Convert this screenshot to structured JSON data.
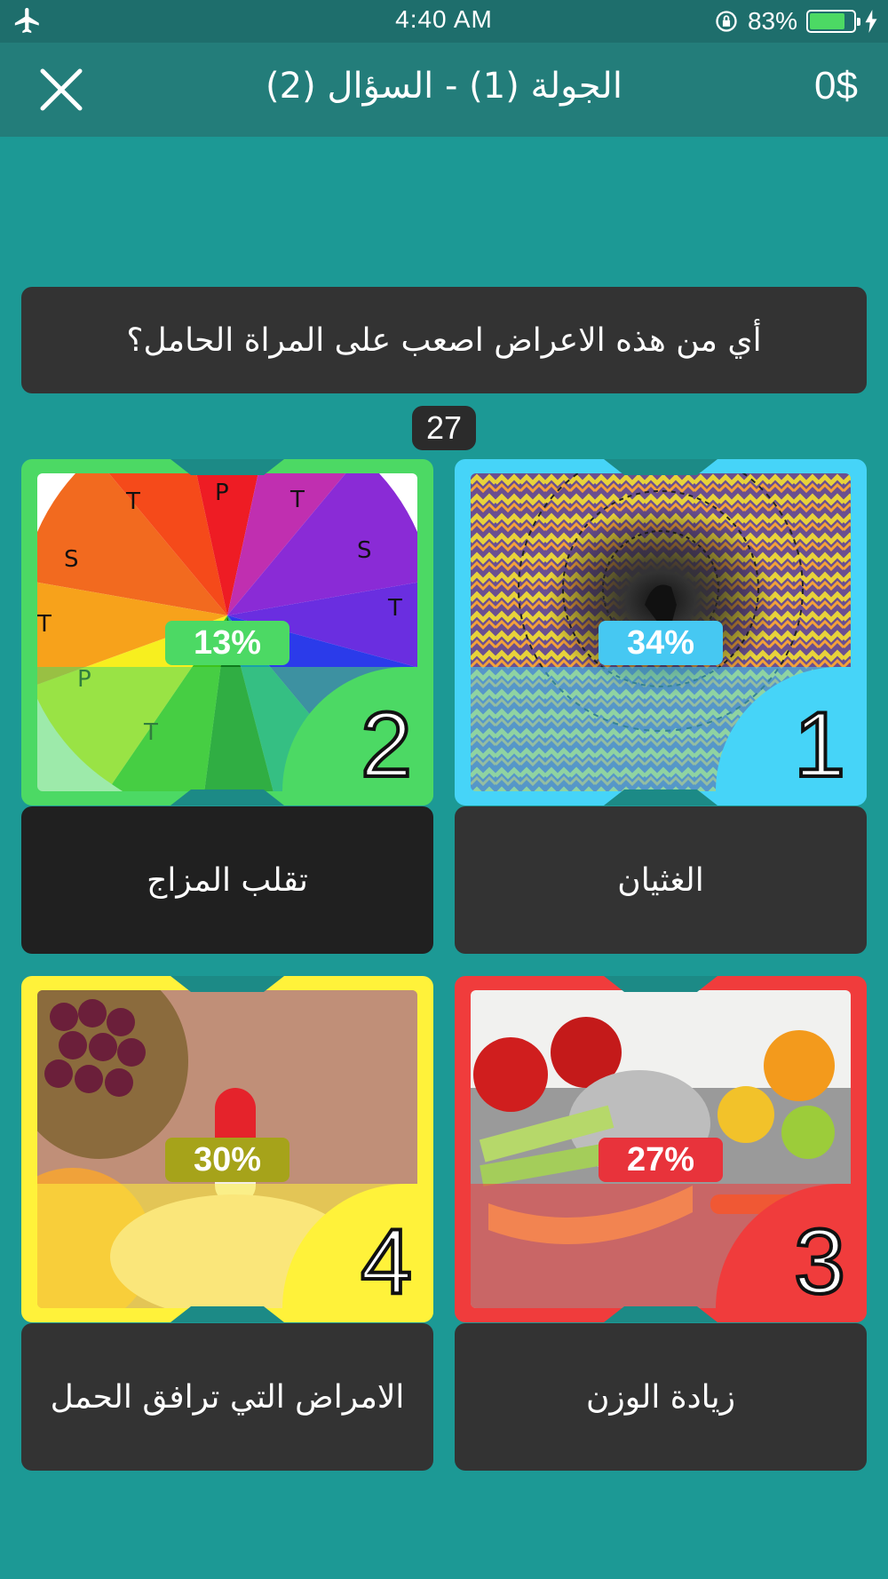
{
  "status_bar": {
    "time": "4:40 AM",
    "battery_percent": "83%",
    "battery_level": 0.83
  },
  "header": {
    "title": "الجولة (1) - السؤال (2)",
    "money": "0$"
  },
  "question": {
    "text": "أي من هذه الاعراض اصعب على المراة الحامل؟"
  },
  "timer": {
    "seconds": "27"
  },
  "options": [
    {
      "number": "1",
      "percent": "34%",
      "answer": "الغثيان",
      "color": "#46d4f8",
      "pct_bg": "#46c8f2",
      "image": "optical-illusion-image"
    },
    {
      "number": "2",
      "percent": "13%",
      "answer": "تقلب المزاج",
      "color": "#4cd964",
      "pct_bg": "#4cd964",
      "image": "color-wheel-image"
    },
    {
      "number": "3",
      "percent": "27%",
      "answer": "زيادة الوزن",
      "color": "#f03c3c",
      "pct_bg": "#e8333b",
      "image": "fruit-scale-image"
    },
    {
      "number": "4",
      "percent": "30%",
      "answer": "الامراض التي ترافق الحمل",
      "color": "#fff23a",
      "pct_bg": "#a6a31a",
      "image": "pill-fruit-image"
    }
  ],
  "colors": {
    "background": "#1c9995",
    "header": "#237d7a",
    "status_bar": "#1e6e6c",
    "panel": "#333333"
  }
}
